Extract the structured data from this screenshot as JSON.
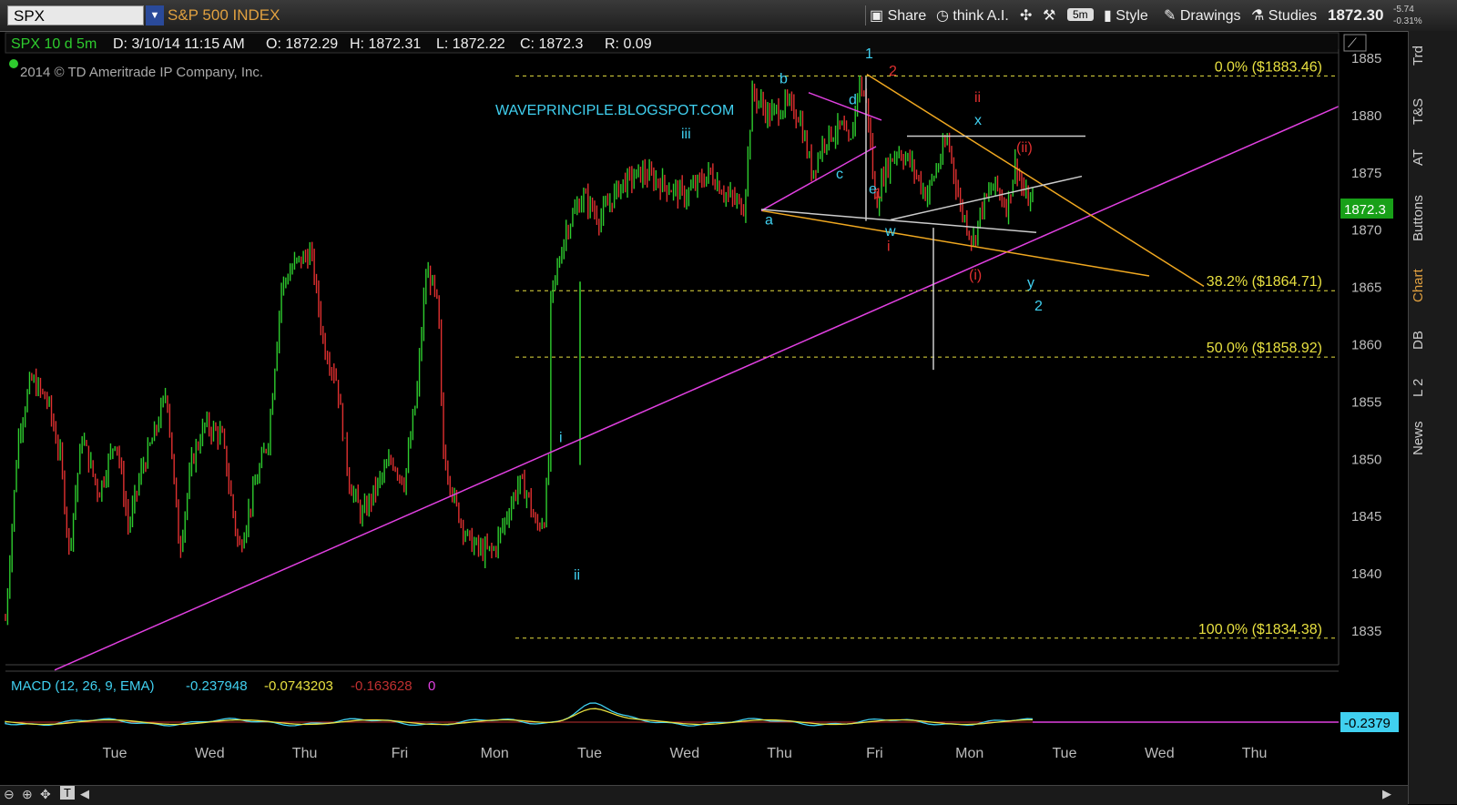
{
  "topbar": {
    "symbol": "SPX",
    "title": "S&P 500 INDEX",
    "buttons": [
      "Share",
      "think A.I.",
      "5m",
      "Style",
      "Drawings",
      "Studies"
    ],
    "last_price": "1872.30",
    "change": "-5.74",
    "change_pct": "-0.31%"
  },
  "infobar": {
    "label": "SPX 10 d 5m",
    "date": "D: 3/10/14 11:15 AM",
    "open": "O: 1872.29",
    "high": "H: 1872.31",
    "low": "L: 1872.22",
    "close": "C: 1872.3",
    "range": "R: 0.09"
  },
  "copyright": "2014 © TD Ameritrade IP Company, Inc.",
  "watermark": "WAVEPRINCIPLE.BLOGSPOT.COM",
  "price_tag": "1872.3",
  "sidebar_tabs": [
    "Trd",
    "T&S",
    "AT",
    "Buttons",
    "Chart",
    "DB",
    "L 2",
    "News"
  ],
  "macd": {
    "label": "MACD (12, 26, 9, EMA)",
    "value": "-0.237948",
    "avg": "-0.0743203",
    "diff": "-0.163628",
    "zero": "0",
    "tag": "-0.2379"
  },
  "colors": {
    "up": "#2ecc2e",
    "down": "#e03030",
    "fib": "#e8e040",
    "trend": "#e040e0",
    "channel": "#f0a820",
    "wave": "#40d0f0",
    "wave_red": "#e03030"
  },
  "chart_data": {
    "type": "candlestick",
    "title": "S&P 500 INDEX",
    "ylim": [
      1832,
      1887
    ],
    "yticks": [
      1835,
      1840,
      1845,
      1850,
      1855,
      1860,
      1865,
      1870,
      1875,
      1880,
      1885
    ],
    "x_days": [
      "Tue",
      "Wed",
      "Thu",
      "Fri",
      "Mon",
      "Tue",
      "Wed",
      "Thu",
      "Fri",
      "Mon",
      "Tue",
      "Wed",
      "Thu"
    ],
    "fib_levels": [
      {
        "label": "0.0%",
        "value": 1883.46,
        "text": "($1883.46)"
      },
      {
        "label": "38.2%",
        "value": 1864.71,
        "text": "($1864.71)"
      },
      {
        "label": "50.0%",
        "value": 1858.92,
        "text": "($1858.92)"
      },
      {
        "label": "100.0%",
        "value": 1834.38,
        "text": "($1834.38)"
      }
    ],
    "close_path": [
      [
        0,
        1836
      ],
      [
        0.3,
        1852
      ],
      [
        0.6,
        1857
      ],
      [
        1.0,
        1855
      ],
      [
        1.3,
        1850
      ],
      [
        1.5,
        1842
      ],
      [
        1.8,
        1852
      ],
      [
        2.2,
        1847
      ],
      [
        2.6,
        1852
      ],
      [
        2.9,
        1844
      ],
      [
        3.2,
        1849
      ],
      [
        3.5,
        1852
      ],
      [
        3.8,
        1856
      ],
      [
        4.1,
        1842
      ],
      [
        4.4,
        1850
      ],
      [
        4.7,
        1853
      ],
      [
        5.1,
        1852
      ],
      [
        5.5,
        1842
      ],
      [
        5.9,
        1848
      ],
      [
        6.2,
        1852
      ],
      [
        6.5,
        1865
      ],
      [
        6.8,
        1867
      ],
      [
        7.2,
        1868
      ],
      [
        7.5,
        1860
      ],
      [
        7.8,
        1857
      ],
      [
        8.1,
        1848
      ],
      [
        8.4,
        1845
      ],
      [
        8.8,
        1848
      ],
      [
        9.1,
        1850
      ],
      [
        9.4,
        1848
      ],
      [
        9.7,
        1856
      ],
      [
        9.9,
        1866
      ],
      [
        10.0,
        1866
      ],
      [
        10.2,
        1863
      ],
      [
        10.3,
        1851
      ],
      [
        10.6,
        1846
      ],
      [
        10.9,
        1843
      ],
      [
        11.2,
        1842
      ],
      [
        11.5,
        1842
      ],
      [
        11.8,
        1845
      ],
      [
        12.1,
        1848
      ],
      [
        12.3,
        1847
      ],
      [
        12.5,
        1844
      ],
      [
        12.7,
        1845
      ],
      [
        12.8,
        1850
      ],
      [
        12.85,
        1864
      ],
      [
        13.2,
        1870
      ],
      [
        13.6,
        1873
      ],
      [
        14.0,
        1871
      ],
      [
        14.5,
        1874
      ],
      [
        15.0,
        1875
      ],
      [
        15.5,
        1874
      ],
      [
        16.0,
        1873
      ],
      [
        16.6,
        1875
      ],
      [
        17.0,
        1873
      ],
      [
        17.4,
        1872
      ],
      [
        17.6,
        1882
      ],
      [
        18.0,
        1880
      ],
      [
        18.4,
        1881
      ],
      [
        18.7,
        1880
      ],
      [
        19.0,
        1875
      ],
      [
        19.3,
        1878
      ],
      [
        19.7,
        1879
      ],
      [
        19.9,
        1877
      ],
      [
        20.1,
        1883
      ],
      [
        20.3,
        1881
      ],
      [
        20.5,
        1872
      ],
      [
        20.7,
        1875
      ],
      [
        21.0,
        1877
      ],
      [
        21.3,
        1876
      ],
      [
        21.7,
        1873
      ],
      [
        22.0,
        1876
      ],
      [
        22.2,
        1878
      ],
      [
        22.5,
        1872
      ],
      [
        22.8,
        1869
      ],
      [
        23.0,
        1872
      ],
      [
        23.3,
        1874
      ],
      [
        23.6,
        1872
      ],
      [
        23.8,
        1876
      ],
      [
        24.0,
        1873
      ],
      [
        24.2,
        1872.3
      ]
    ],
    "wave_labels_cyan": [
      "b",
      "1",
      "d",
      "iii",
      "c",
      "e",
      "a",
      "w",
      "x",
      "y",
      "2",
      "i",
      "ii"
    ],
    "wave_labels_red": [
      "2",
      "1",
      "ii",
      "(ii)",
      "(i)",
      "i"
    ]
  }
}
